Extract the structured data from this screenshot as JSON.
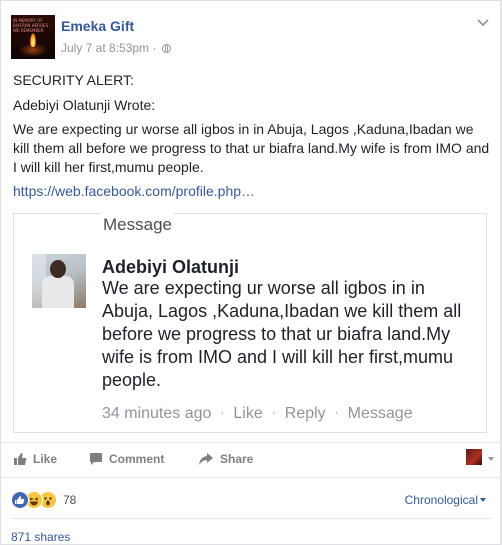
{
  "post": {
    "author": "Emeka Gift",
    "timestamp": "July 7 at 8:53pm",
    "separator": "·",
    "avatar_caption": "IN MEMORY OF BIAFRAN HEROES · WE REMEMBER",
    "paragraphs": [
      "SECURITY ALERT:",
      "Adebiyi Olatunji Wrote:",
      "We are expecting ur worse all igbos in in Abuja, Lagos ,Kaduna,Ibadan we kill them all before we progress to that ur biafra land.My wife is from IMO and I will kill her first,mumu people."
    ],
    "link_text": "https://web.facebook.com/profile.php…"
  },
  "embed": {
    "label": "Message",
    "name": "Adebiyi Olatunji",
    "text": "We are expecting ur worse all igbos in in Abuja, Lagos ,Kaduna,Ibadan we kill them all before we progress to that ur biafra land.My wife is from IMO and I will kill her first,mumu people.",
    "time": "34 minutes ago",
    "dot": "·",
    "like": "Like",
    "reply": "Reply",
    "message": "Message"
  },
  "actions": {
    "like": "Like",
    "comment": "Comment",
    "share": "Share"
  },
  "reactions": {
    "count": "78",
    "types": [
      "like-icon",
      "haha-icon",
      "wow-icon"
    ],
    "colors": {
      "like": "#4267b2",
      "face": "#f7c744"
    }
  },
  "sort": {
    "label": "Chronological"
  },
  "shares": {
    "label": "871 shares"
  },
  "colors": {
    "link": "#365899",
    "muted": "#90949c"
  }
}
